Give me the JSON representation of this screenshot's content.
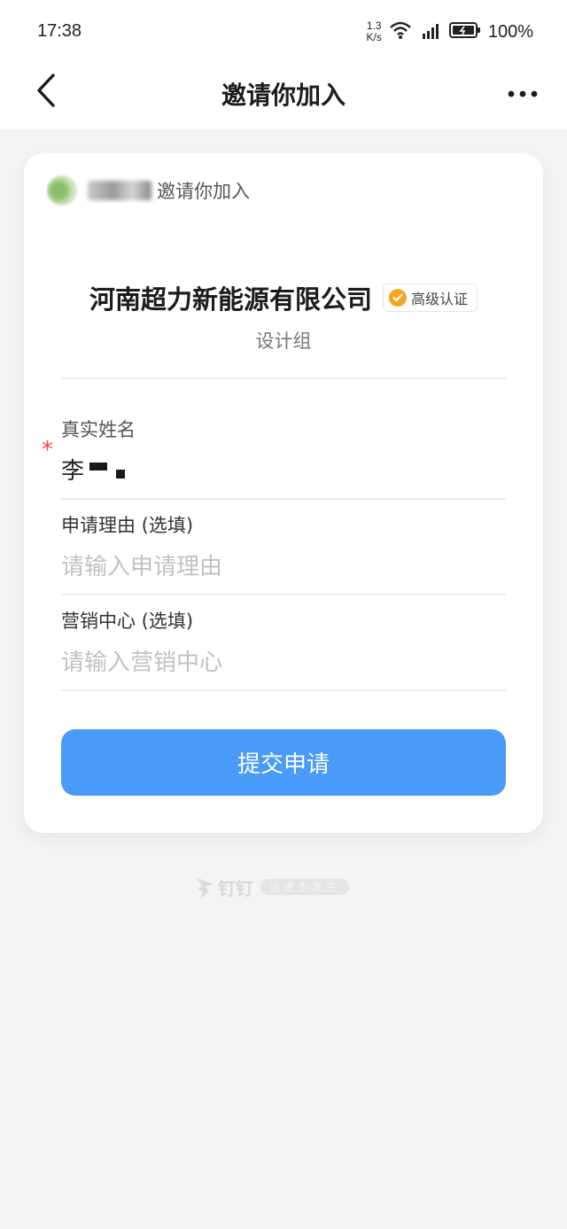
{
  "status_bar": {
    "time": "17:38",
    "net_speed_value": "1.3",
    "net_speed_unit": "K/s",
    "battery": "100%"
  },
  "nav": {
    "title": "邀请你加入",
    "back_icon": "chevron-left-icon",
    "more_icon": "more-horizontal-icon"
  },
  "card": {
    "inviter_action": "邀请你加入",
    "company_name": "河南超力新能源有限公司",
    "cert_badge": "高级认证",
    "group_name": "设计组",
    "fields": [
      {
        "label": "真实姓名",
        "value": "李",
        "required": true
      },
      {
        "label": "申请理由 (选填)",
        "placeholder": "请输入申请理由"
      },
      {
        "label": "营销中心 (选填)",
        "placeholder": "请输入营销中心"
      }
    ],
    "submit_label": "提交申请"
  },
  "footer": {
    "brand": "钉钉",
    "slogan": "让进步发生"
  },
  "colors": {
    "accent": "#4a9bf7",
    "required": "#ef4b4b",
    "badge": "#f5a623",
    "background": "#f4f4f5"
  }
}
